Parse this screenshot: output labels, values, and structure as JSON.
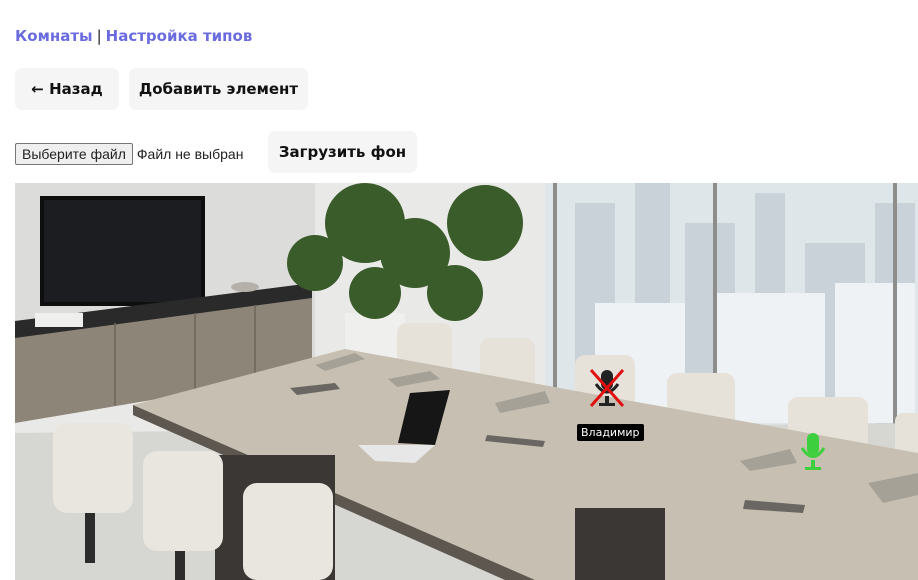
{
  "breadcrumb": {
    "rooms": "Комнаты",
    "separator": "|",
    "types": "Настройка типов"
  },
  "toolbar": {
    "back_label": "← Назад",
    "add_label": "Добавить элемент"
  },
  "file_upload": {
    "choose_label": "Выберите файл",
    "status": "Файл не выбран",
    "upload_label": "Загрузить фон"
  },
  "room_canvas": {
    "markers": [
      {
        "label": "Владимир",
        "state": "muted",
        "color": "#e01010",
        "icon": "mic-muted-icon"
      },
      {
        "label": "",
        "state": "active",
        "color": "#3ecf3e",
        "icon": "mic-icon"
      }
    ]
  },
  "colors": {
    "link": "#6b6be0",
    "button_bg": "#f5f5f5"
  }
}
